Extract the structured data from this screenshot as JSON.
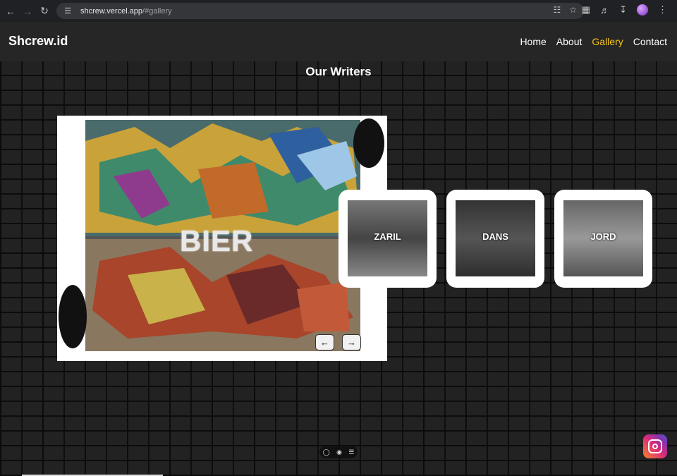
{
  "browser": {
    "url_host": "shcrew.vercel.app",
    "url_path": "/#gallery"
  },
  "site": {
    "brand": "Shcrew.id",
    "nav": [
      {
        "label": "Home"
      },
      {
        "label": "About"
      },
      {
        "label": "Gallery"
      },
      {
        "label": "Contact"
      }
    ],
    "active_nav": "Gallery",
    "accent": "#f5c518"
  },
  "gallery": {
    "title": "Our Writers",
    "main": {
      "label": "BIER"
    },
    "thumbs": [
      {
        "label": "ZARIL"
      },
      {
        "label": "DANS"
      },
      {
        "label": "JORD"
      }
    ],
    "prev_icon": "arrow-left-icon",
    "next_icon": "arrow-right-icon"
  },
  "icons": {
    "back": "arrow-left-icon",
    "forward": "arrow-right-icon",
    "reload": "reload-icon",
    "instagram": "instagram-icon"
  }
}
